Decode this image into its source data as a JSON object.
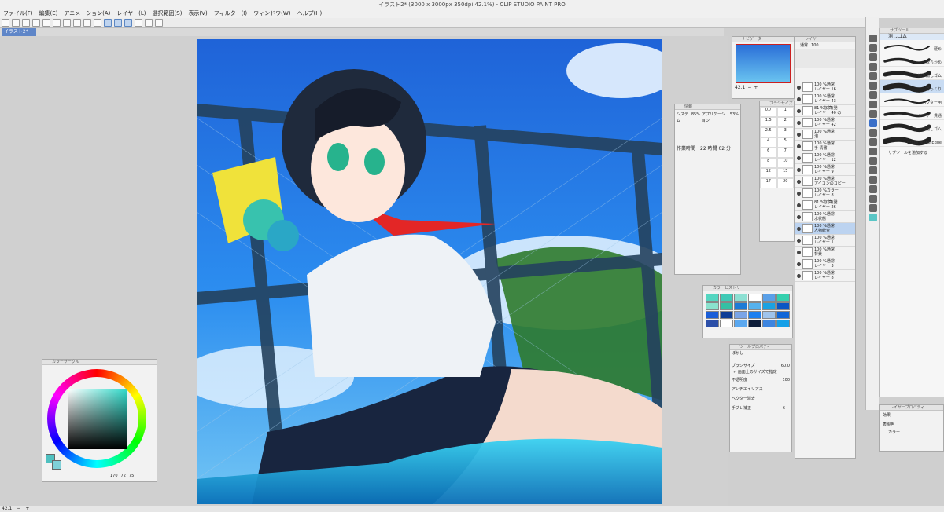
{
  "window": {
    "title": "イラスト2* (3000 x 3000px 350dpi 42.1%) - CLIP STUDIO PAINT PRO"
  },
  "menu": [
    "ファイル(F)",
    "編集(E)",
    "アニメーション(A)",
    "レイヤー(L)",
    "選択範囲(S)",
    "表示(V)",
    "フィルター(I)",
    "ウィンドウ(W)",
    "ヘルプ(H)"
  ],
  "tabs": [
    {
      "label": "イラスト2*"
    }
  ],
  "navigator": {
    "title": "ナビゲーター",
    "zoom": "42.1"
  },
  "info": {
    "title": "情報",
    "system_label": "システム",
    "system_value": "85%",
    "app_label": "アプリケーション",
    "app_value": "53%",
    "time_label": "作業時間",
    "time_value": "22 時間 02 分"
  },
  "brush_sizes": {
    "title": "ブラシサイズ",
    "values": [
      "0.7",
      "1",
      "1.5",
      "2",
      "2.5",
      "3",
      "4",
      "5",
      "6",
      "7",
      "8",
      "10",
      "12",
      "15",
      "17",
      "20"
    ]
  },
  "color_history": {
    "title": "カラーヒストリー",
    "colors": [
      "#54d6c1",
      "#3fc9b6",
      "#8de0d3",
      "#ffffff",
      "#5aa0e8",
      "#35d0ae",
      "#8ae2ce",
      "#34c0a4",
      "#1e7bd6",
      "#56b2ee",
      "#1aa2e2",
      "#0a56c4",
      "#1a5ed8",
      "#0d3d96",
      "#7aa4e6",
      "#1b7ff0",
      "#9fc4ec",
      "#0f66d8",
      "#2c4fa8",
      "#ffffff",
      "#5ba8f0",
      "#0e1d3a",
      "#3d85e0",
      "#15a0e8"
    ]
  },
  "tool_property": {
    "title": "ツールプロパティ",
    "tool_name": "ぼかし",
    "brush_size_label": "ブラシサイズ",
    "brush_size_value": "60.0",
    "size_on_canvas": "画面上のサイズで指定",
    "opacity_label": "不透明度",
    "opacity_value": "100",
    "antialias_label": "アンチエイリアス",
    "vector_label": "ベクター消去",
    "stabilizer_label": "手ブレ補正",
    "stabilizer_value": "6"
  },
  "layers": {
    "title": "レイヤー",
    "blend": "通常",
    "opacity": "100",
    "items": [
      {
        "line1": "100 %通常",
        "line2": "レイヤー 16"
      },
      {
        "line1": "100 %通常",
        "line2": "レイヤー 43"
      },
      {
        "line1": "81 %加算(発",
        "line2": "レイヤー 40 の"
      },
      {
        "line1": "100 %通常",
        "line2": "レイヤー 42"
      },
      {
        "line1": "100 %通常",
        "line2": "泡"
      },
      {
        "line1": "100 %通常",
        "line2": "手 清書"
      },
      {
        "line1": "100 %通常",
        "line2": "レイヤー 12"
      },
      {
        "line1": "100 %通常",
        "line2": "レイヤー 9"
      },
      {
        "line1": "100 %通常",
        "line2": "アイコンのコピー"
      },
      {
        "line1": "100 %カラー",
        "line2": "レイヤー 8"
      },
      {
        "line1": "81 %加算(発",
        "line2": "レイヤー 26"
      },
      {
        "line1": "100 %通常",
        "line2": "水状態"
      },
      {
        "line1": "100 %通常",
        "line2": "人物統合"
      },
      {
        "line1": "100 %通常",
        "line2": "レイヤー 1"
      },
      {
        "line1": "100 %通常",
        "line2": "背景"
      },
      {
        "line1": "100 %通常",
        "line2": "レイヤー 3"
      },
      {
        "line1": "100 %通常",
        "line2": "レイヤー 8"
      }
    ]
  },
  "subtool": {
    "title": "サブツール",
    "group": "消しゴム",
    "items": [
      "硬め",
      "軟らかめ",
      "擦り消しゴム",
      "ざっくり",
      "ベクター用",
      "レイヤー貫通",
      "スナップ消しゴム",
      "Erase Alone Edge"
    ],
    "add_label": "サブツールを追加する"
  },
  "layer_property": {
    "title": "レイヤープロパティ",
    "effect_label": "効果",
    "display_color_label": "表現色",
    "display_color_value": "カラー"
  },
  "color_circle": {
    "title": "カラーサークル",
    "h": "170",
    "s": "72",
    "v": "75"
  },
  "status": {
    "zoom": "42.1"
  }
}
